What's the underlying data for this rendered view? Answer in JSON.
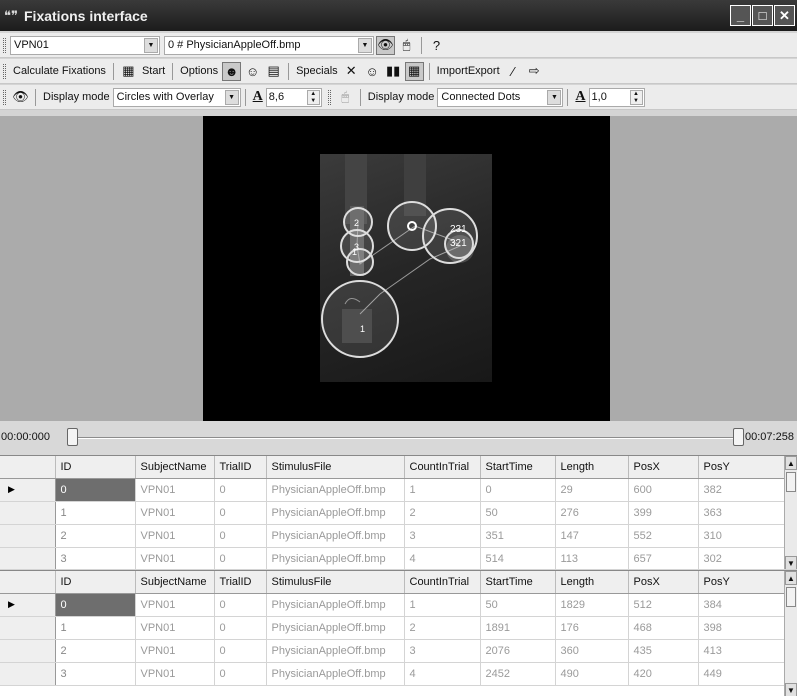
{
  "window": {
    "title": "Fixations interface",
    "controls": [
      "_",
      "□",
      "✕"
    ]
  },
  "toolbar1": {
    "subject": "VPN01",
    "stimulus": "0 # PhysicianAppleOff.bmp"
  },
  "toolbar2": {
    "calculate_label": "Calculate Fixations",
    "start_label": "Start",
    "options_label": "Options",
    "specials_label": "Specials",
    "importexport_label": "ImportExport"
  },
  "toolbar3": {
    "display_mode_label_1": "Display mode",
    "display_mode_value_1": "Circles with Overlay",
    "font_size_1": "8,6",
    "display_mode_label_2": "Display mode",
    "display_mode_value_2": "Connected Dots",
    "font_size_2": "1,0"
  },
  "stimulus_overlay": {
    "labels": [
      "2",
      "3",
      "1",
      "231",
      "321",
      "1"
    ]
  },
  "timeline": {
    "start": "00:00:000",
    "end": "00:07:258"
  },
  "columns": [
    "ID",
    "SubjectName",
    "TrialID",
    "StimulusFile",
    "CountInTrial",
    "StartTime",
    "Length",
    "PosX",
    "PosY"
  ],
  "grid1": {
    "rows": [
      [
        "0",
        "VPN01",
        "0",
        "PhysicianAppleOff.bmp",
        "1",
        "0",
        "29",
        "600",
        "382"
      ],
      [
        "1",
        "VPN01",
        "0",
        "PhysicianAppleOff.bmp",
        "2",
        "50",
        "276",
        "399",
        "363"
      ],
      [
        "2",
        "VPN01",
        "0",
        "PhysicianAppleOff.bmp",
        "3",
        "351",
        "147",
        "552",
        "310"
      ],
      [
        "3",
        "VPN01",
        "0",
        "PhysicianAppleOff.bmp",
        "4",
        "514",
        "113",
        "657",
        "302"
      ]
    ]
  },
  "grid2": {
    "rows": [
      [
        "0",
        "VPN01",
        "0",
        "PhysicianAppleOff.bmp",
        "1",
        "50",
        "1829",
        "512",
        "384"
      ],
      [
        "1",
        "VPN01",
        "0",
        "PhysicianAppleOff.bmp",
        "2",
        "1891",
        "176",
        "468",
        "398"
      ],
      [
        "2",
        "VPN01",
        "0",
        "PhysicianAppleOff.bmp",
        "3",
        "2076",
        "360",
        "435",
        "413"
      ],
      [
        "3",
        "VPN01",
        "0",
        "PhysicianAppleOff.bmp",
        "4",
        "2452",
        "490",
        "420",
        "449"
      ]
    ]
  }
}
